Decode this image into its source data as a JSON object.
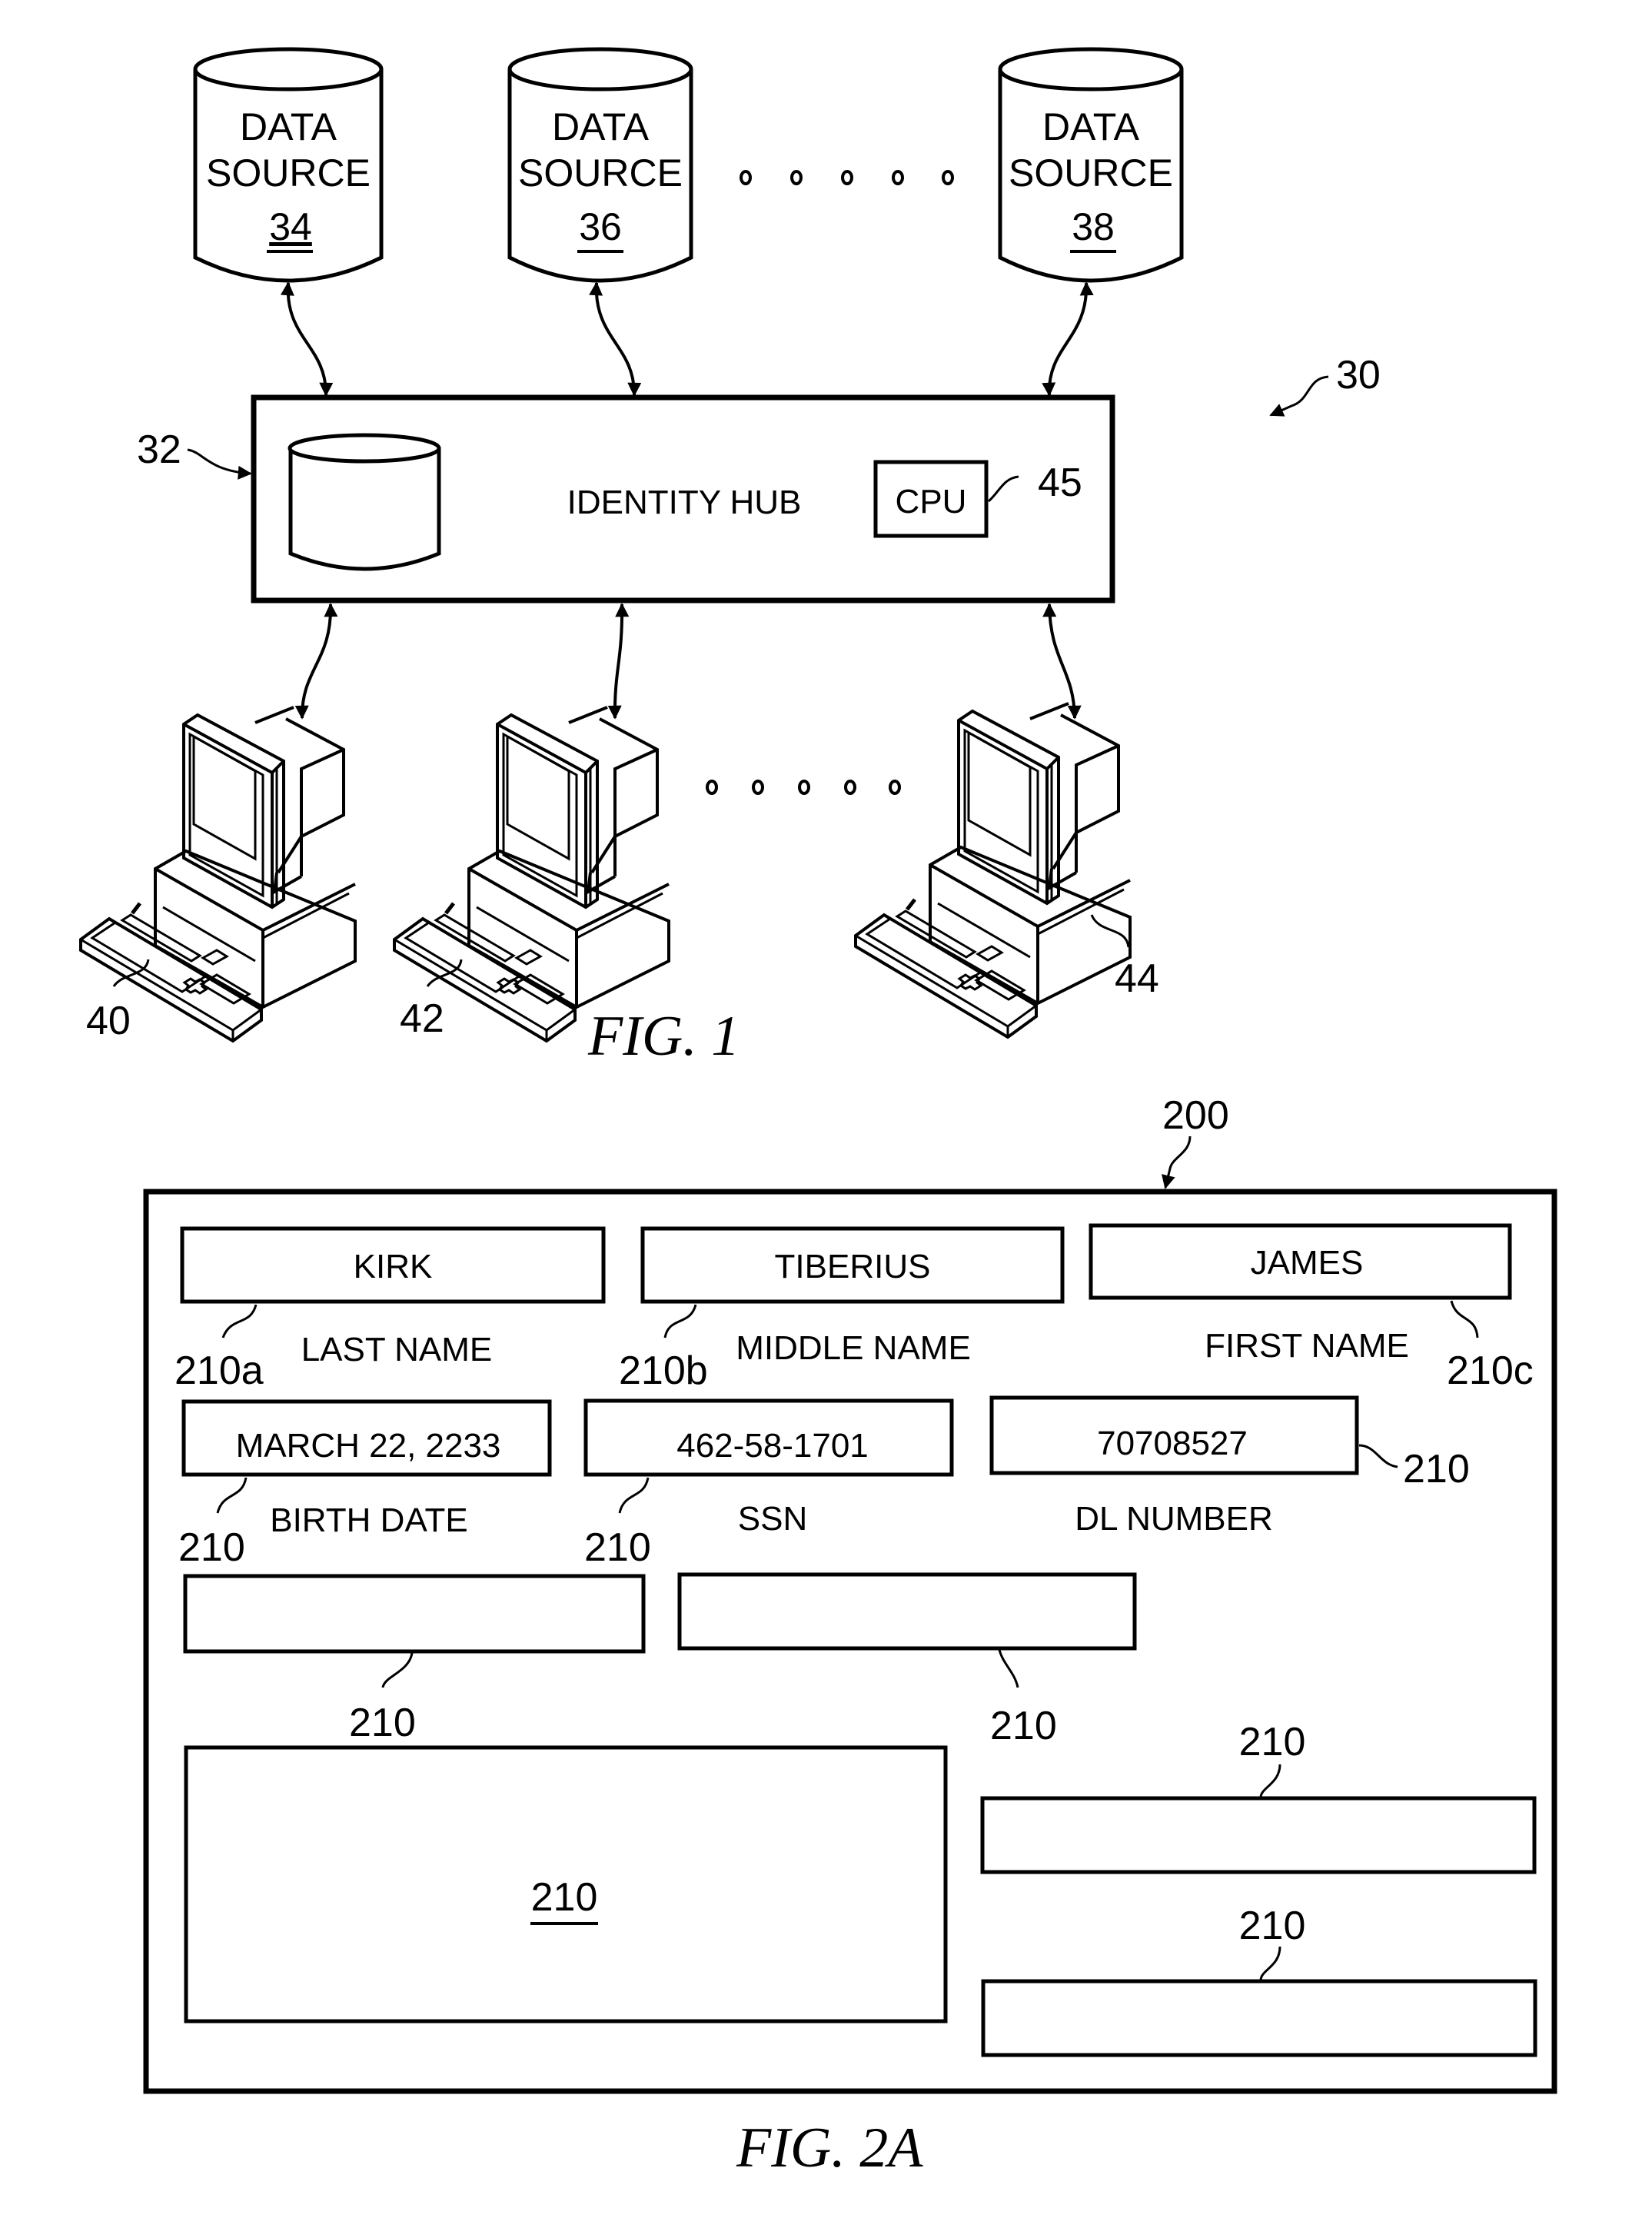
{
  "fig1": {
    "caption": "FIG. 1",
    "system_ref": "30",
    "data_sources": [
      {
        "line1": "DATA",
        "line2": "SOURCE",
        "ref": "34"
      },
      {
        "line1": "DATA",
        "line2": "SOURCE",
        "ref": "36"
      },
      {
        "line1": "DATA",
        "line2": "SOURCE",
        "ref": "38"
      }
    ],
    "identity_hub": {
      "label": "IDENTITY HUB",
      "ref": "32",
      "cpu_label": "CPU",
      "cpu_ref": "45"
    },
    "computers": [
      {
        "ref": "40"
      },
      {
        "ref": "42"
      },
      {
        "ref": "44"
      }
    ]
  },
  "fig2a": {
    "caption": "FIG. 2A",
    "screen_ref": "200",
    "fields": [
      {
        "value": "KIRK",
        "caption": "LAST NAME",
        "ref": "210a"
      },
      {
        "value": "TIBERIUS",
        "caption": "MIDDLE NAME",
        "ref": "210b"
      },
      {
        "value": "JAMES",
        "caption": "FIRST NAME",
        "ref": "210c"
      },
      {
        "value": "MARCH 22, 2233",
        "caption": "BIRTH DATE",
        "ref": "210"
      },
      {
        "value": "462-58-1701",
        "caption": "SSN",
        "ref": "210"
      },
      {
        "value": "70708527",
        "caption": "DL NUMBER",
        "ref": "210"
      },
      {
        "value": "",
        "caption": "",
        "ref": "210"
      },
      {
        "value": "",
        "caption": "",
        "ref": "210"
      },
      {
        "value": "",
        "caption": "",
        "ref": "210"
      },
      {
        "value": "",
        "caption": "",
        "ref": "210"
      },
      {
        "value": "",
        "caption": "",
        "ref": "210"
      }
    ]
  }
}
